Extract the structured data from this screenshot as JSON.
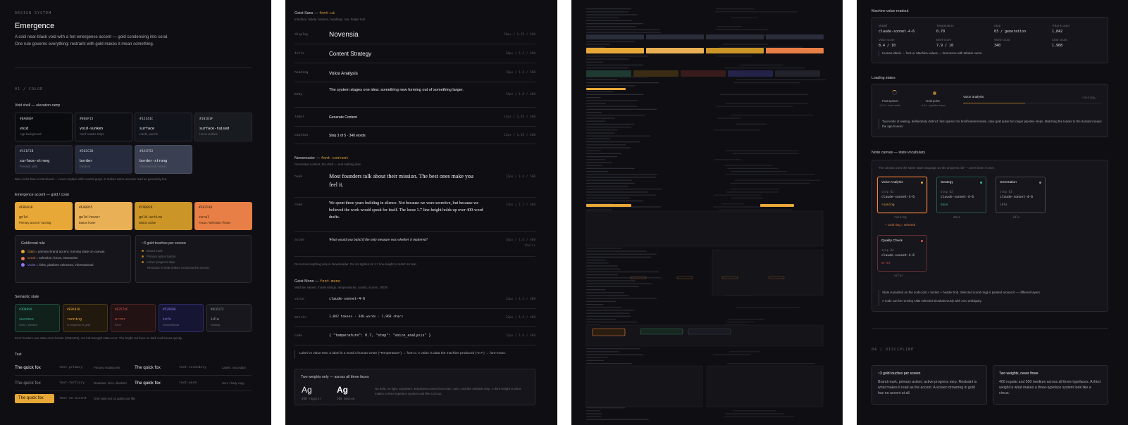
{
  "p1": {
    "eyebrow": "DESIGN SYSTEM",
    "title": "Emergence",
    "intro1": "A cool near-black void with a hot emergence accent — gold condensing into coral.",
    "intro2": "One rule governs everything: restraint with gold makes it mean something.",
    "section": "01 / COLOR",
    "void_title": "Void shell — elevation ramp",
    "void_swatches": [
      {
        "hex": "#0A0B0F",
        "name": "void",
        "desc": "App background"
      },
      {
        "hex": "#0E0F15",
        "name": "void-sunken",
        "desc": "Card header strips"
      },
      {
        "hex": "#12141C",
        "name": "surface",
        "desc": "Cards, panels"
      },
      {
        "hex": "#181B1F",
        "name": "surface-raised",
        "desc": "Hover surface"
      },
      {
        "hex": "#1C1F2B",
        "name": "surface-strong",
        "desc": "Pressed, pills"
      },
      {
        "hex": "#262C3D",
        "name": "border",
        "desc": "Dividers"
      },
      {
        "hex": "#3A3F52",
        "name": "border-strong",
        "desc": "Emphasized borders"
      }
    ],
    "void_note": "Blue-violet bias is intentional — never replace with neutral grays. It makes warm accents read as genuinely hot.",
    "accent_title": "Emergence accent — gold / coral",
    "accent_swatches": [
      {
        "hex": "#E8A838",
        "name": "gold",
        "desc": "Primary accent / running",
        "bg": "#e8a838"
      },
      {
        "hex": "#EAB055",
        "name": "gold-hover",
        "desc": "Button hover",
        "bg": "#eab055"
      },
      {
        "hex": "#C9B829",
        "name": "gold-active",
        "desc": "Button active",
        "bg": "#cc9528"
      },
      {
        "hex": "#E87F46",
        "name": "coral",
        "desc": "Focus / selection / hover",
        "bg": "#e87f46"
      }
    ],
    "rule_card": {
      "title": "Gold/coral rule",
      "items": [
        {
          "b": "Gold",
          "t": " = primary brand accent, running state on canvas",
          "c": "#e8a838"
        },
        {
          "b": "Coral",
          "t": " = selection, focus, interaction",
          "c": "#e87f46"
        },
        {
          "b": "Violet",
          "t": " = links, platform selectors, informational",
          "c": "#8a7cf0"
        }
      ]
    },
    "touch_card": {
      "title": "~3 gold touches per screen",
      "items": [
        "Brand mark",
        "Primary action button",
        "Active progress step"
      ],
      "note": "Restraint is what makes it read as the accent."
    },
    "semantic_title": "Semantic state",
    "semantic": [
      {
        "hex": "#3DB89A",
        "name": "success",
        "desc": "Done / passed",
        "bg": "#10201b",
        "bd": "#1f4a3c",
        "c": "#3db89a"
      },
      {
        "hex": "#E8A838",
        "name": "running",
        "desc": "In progress in gold",
        "bg": "#21190d",
        "bd": "#4a3718",
        "c": "#e8a838"
      },
      {
        "hex": "#E2574F",
        "name": "error",
        "desc": "Error",
        "bg": "#221213",
        "bd": "#4b2324",
        "c": "#e2574f"
      },
      {
        "hex": "#5296D6",
        "name": "info",
        "desc": "Informational",
        "bg": "#161634",
        "bd": "#2d2d62",
        "c": "#8a7cf0"
      },
      {
        "hex": "#6C6172",
        "name": "idle",
        "desc": "Waiting",
        "bg": "#17171d",
        "bd": "#2e2e38",
        "c": "#9a9aa6"
      }
    ],
    "semantic_note": "Error borders use state-error-border (#4B2425), not full-strength state-error. The bright red lives on dark void boxes quietly.",
    "text_title": "Text",
    "text_rows": [
      {
        "s1": "The quick fox",
        "k1": "text-primary",
        "d1": "Primary reading text",
        "s2": "The quick fox",
        "k2": "text-secondary",
        "d2": "Labels, secondary"
      },
      {
        "s1": "The quick fox",
        "k1": "text-tertiary",
        "d1": "Metadata, hints, disabled",
        "s2": "The quick fox",
        "k2": "text-warm",
        "d2": "Hero / body copy"
      }
    ],
    "on_accent": {
      "sample": "The quick fox",
      "key": "text-on-accent",
      "desc": "Only valid text on gold/coral fills"
    }
  },
  "p2": {
    "geist_title": "Geist Sans — ",
    "geist_var": "font-ui",
    "geist_sub": "Interface, labels, buttons, headings, nav, helper text",
    "geist_rows": [
      {
        "label": "display",
        "sample": "Novensia",
        "spec": "28px / 1.25 / 500"
      },
      {
        "label": "title",
        "sample": "Content Strategy",
        "spec": "20px / 1.3 / 500"
      },
      {
        "label": "heading",
        "sample": "Voice Analysis",
        "spec": "16px / 1.4 / 500"
      },
      {
        "label": "body",
        "sample": "The system stages one idea: something new forming out of something larger.",
        "spec": "15px / 1.6 / 400"
      },
      {
        "label": "label",
        "sample": "Generate Content",
        "spec": "13px / 1.45 / 500"
      },
      {
        "label": "caption",
        "sample": "Step 3 of 5 · 340 words",
        "spec": "12px / 1.45 / 400"
      }
    ],
    "news_title": "Newsreader — ",
    "news_var": "font-content",
    "news_sub": "Generated content, the draft — and nothing else",
    "news_rows": [
      {
        "label": "hook",
        "sample": "Most founders talk about their mission. The best ones make you feel it.",
        "spec": "21px / 1.4 / 500"
      },
      {
        "label": "read",
        "sample": "We spent three years building in silence. Not because we were secretive, but because we believed the work would speak for itself. The loose 1.7 line-height holds up over 400-word drafts.",
        "spec": "17px / 1.7 / 400"
      },
      {
        "label": "aside",
        "sample": "What would you build if the only measure was whether it mattered?",
        "spec": "16px / 1.6 / 400",
        "spec2": "italic"
      }
    ],
    "news_note": "Do not set anything else in Newsreader. Do not tighten its 1.7 line-height to match UI text.",
    "mono_title": "Geist Mono — ",
    "mono_var": "font-mono",
    "mono_sub": "Machine values: model strings, temperatures, counts, scores, JSON",
    "mono_rows": [
      {
        "label": "value",
        "sample": "claude-sonnet-4-6",
        "spec": "13px / 1.5 / 400"
      },
      {
        "label": "metric",
        "sample": "1,842 tokens · 340 words · 1,968 chars",
        "spec": "12px / 1.5 / 400"
      },
      {
        "label": "code",
        "sample": "{ \"temperature\": 0.7, \"step\": \"voice_analysis\" }",
        "spec": "13px / 1.6 / 400"
      }
    ],
    "mono_note": "Label vs value test: a label is a word a human wrote (\"Temperature\") → font-ui. A value is data the machine produced (\"0.7\") → font-mono.",
    "weights_title": "Two weights only — across all three faces",
    "w1": {
      "ag": "Ag",
      "lbl": "400 regular"
    },
    "w2": {
      "ag": "Ag",
      "lbl": "500 medium"
    },
    "weights_note": "No bold, no light, anywhere. Emphasis comes from size, color, and the 400/500 step. A third weight is what makes a three-typeface system look like a circus."
  },
  "p4": {
    "readout_title": "Machine value readout",
    "readout": [
      {
        "k": "Model",
        "v": "claude-sonnet-4-6"
      },
      {
        "k": "Temperature",
        "v": "0.70"
      },
      {
        "k": "Step",
        "v": "03 / generation"
      },
      {
        "k": "Tokens used",
        "v": "1,842"
      },
      {
        "k": "Voice score",
        "v": "8.4 / 10"
      },
      {
        "k": "Brief score",
        "v": "7.9 / 10"
      },
      {
        "k": "Word count",
        "v": "340"
      },
      {
        "k": "Char count",
        "v": "1,968"
      }
    ],
    "readout_note": "Human labels → font-ui. Machine values → font-mono with tabular nums.",
    "loading_title": "Loading states",
    "spin_lbl": "Fast spinner",
    "spin_sub": "<0.7s · brief waits",
    "pulse_lbl": "Gold pulse",
    "pulse_sub": "~1.4s · pipeline steps",
    "loading_step": "Voice analysis",
    "loading_status": "running…",
    "loading_note": "Two kinds of waiting, deliberately distinct: fast spinner for brief/indeterminate, slow gold pulse for longer pipeline steps. Matching the loader to the duration keeps the app honest.",
    "canvas_title": "Node canvas — state vocabulary",
    "canvas_sub": "The canvas uses the same state language as the progress rail — users learn it once.",
    "nodes": [
      {
        "t": "Voice Analysis",
        "s": "step 01",
        "m": "claude-sonnet-4-6",
        "st": "running",
        "c": "#e8a838",
        "cap": "running"
      },
      {
        "t": "Strategy",
        "s": "step 02",
        "m": "claude-sonnet-4-6",
        "st": "done",
        "c": "#3db89a",
        "cap": "done"
      },
      {
        "t": "Generation",
        "s": "step 03",
        "m": "claude-sonnet-4-6",
        "st": "idle",
        "c": "#8c8c98",
        "cap": "idle"
      },
      {
        "t": "Quality Check",
        "s": "step 04",
        "m": "claude-sonnet-4-6",
        "st": "error",
        "c": "#e2574f",
        "cap": "error"
      }
    ],
    "coral_tag": "+ coral ring = selected",
    "canvas_note1": "State is painted on the node (dot + border + header tint). Selected (coral ring) is painted around it — different layers.",
    "canvas_note2": "A node can be running AND selected simultaneously with zero ambiguity.",
    "disc_eyebrow": "04 / DISCIPLINE",
    "disc": [
      {
        "t": "~3 gold touches per screen",
        "b": "Brand mark, primary action, active progress step. Restraint is what makes it read as the accent. A screen drowning in gold has no accent at all."
      },
      {
        "t": "Two weights, never three",
        "b": "400 regular and 500 medium across all three typefaces. A third weight is what makes a three-typeface system look like a circus."
      }
    ]
  }
}
